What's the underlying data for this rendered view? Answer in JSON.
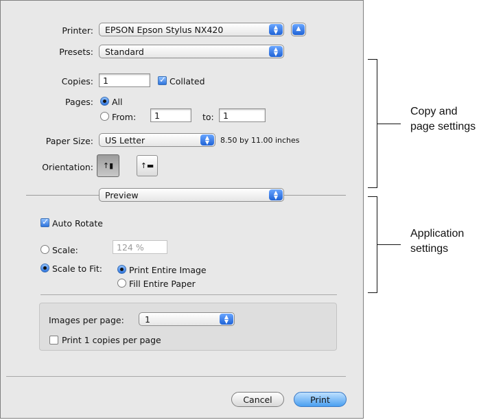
{
  "printer": {
    "label": "Printer:",
    "value": "EPSON Epson Stylus NX420"
  },
  "presets": {
    "label": "Presets:",
    "value": "Standard"
  },
  "copies": {
    "label": "Copies:",
    "value": "1",
    "collated_label": "Collated",
    "collated_checked": true
  },
  "pages": {
    "label": "Pages:",
    "all_label": "All",
    "from_label": "From:",
    "from_value": "1",
    "to_label": "to:",
    "to_value": "1",
    "selected": "All"
  },
  "paper_size": {
    "label": "Paper Size:",
    "value": "US Letter",
    "dimensions": "8.50 by 11.00 inches"
  },
  "orientation": {
    "label": "Orientation:",
    "selected": "portrait"
  },
  "section_popup": {
    "value": "Preview"
  },
  "auto_rotate": {
    "label": "Auto Rotate",
    "checked": true
  },
  "scale": {
    "label": "Scale:",
    "value": "124 %",
    "selected": false
  },
  "scale_to_fit": {
    "label": "Scale to Fit:",
    "selected": true,
    "options": [
      "Print Entire Image",
      "Fill Entire Paper"
    ],
    "selected_option": "Print Entire Image"
  },
  "images_per_page": {
    "label": "Images per page:",
    "value": "1",
    "copies_label": "Print 1 copies per page",
    "copies_checked": false
  },
  "buttons": {
    "cancel": "Cancel",
    "print": "Print"
  },
  "annotations": {
    "copy_page_line1": "Copy and",
    "copy_page_line2": "page settings",
    "application_line1": "Application",
    "application_line2": "settings"
  },
  "colors": {
    "dialog_bg": "#e8e8e8",
    "accent": "#2f74dc"
  }
}
